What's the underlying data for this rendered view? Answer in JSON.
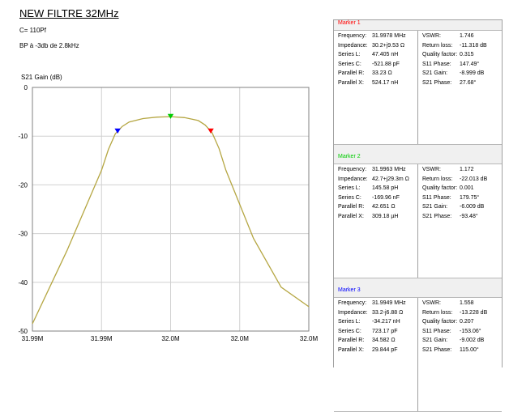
{
  "header": {
    "title": "NEW FILTRE 32MHz",
    "note1": "C= 110Pf",
    "note2": "BP à -3db de 2.8kHz"
  },
  "chart_data": {
    "type": "line",
    "title": "",
    "xlabel": "",
    "ylabel": "S21 Gain (dB)",
    "xlim": [
      31.999,
      32.001
    ],
    "ylim": [
      -50,
      0
    ],
    "x_tick_labels": [
      "31.99M",
      "31.99M",
      "32.0M",
      "32.0M",
      "32.0M"
    ],
    "y_tick_labels": [
      "0",
      "-10",
      "-20",
      "-30",
      "-40",
      "-50"
    ],
    "grid": true,
    "line_color": "#b5a642",
    "series": [
      {
        "x": [
          31.999,
          31.99925,
          31.9995,
          31.99955,
          31.9996,
          31.99965,
          31.9997,
          31.9998,
          31.9999,
          32.0,
          32.0001,
          32.0002,
          32.00025,
          32.0003,
          32.00035,
          32.0004,
          32.0006,
          32.0008,
          32.001
        ],
        "values": [
          -48.5,
          -33.5,
          -17,
          -12.7,
          -9.5,
          -8.0,
          -7.1,
          -6.4,
          -6.1,
          -6.0,
          -6.2,
          -6.8,
          -7.7,
          -9.3,
          -12.5,
          -17,
          -31,
          -41,
          -45
        ]
      }
    ],
    "markers": [
      {
        "label": "1",
        "x": 31.9978,
        "y": -8.999,
        "color": "#ff0000"
      },
      {
        "label": "2",
        "x": 31.9963,
        "y": -6.009,
        "color": "#00cc00"
      },
      {
        "label": "3",
        "x": 31.9949,
        "y": -9.002,
        "color": "#0000ff"
      }
    ]
  },
  "panel": {
    "markers": [
      {
        "title": "Marker 1",
        "color": "#ff0000",
        "left": [
          {
            "k": "Frequency:",
            "v": "31.9978 MHz"
          },
          {
            "k": "Impedance:",
            "v": "30.2+j9.53 Ω"
          },
          {
            "k": "Series L:",
            "v": "47.405 nH"
          },
          {
            "k": "Series C:",
            "v": "-521.88 pF"
          },
          {
            "k": "Parallel R:",
            "v": "33.23 Ω"
          },
          {
            "k": "Parallel X:",
            "v": "524.17 nH"
          }
        ],
        "right": [
          {
            "k": "VSWR:",
            "v": "1.746"
          },
          {
            "k": "Return loss:",
            "v": "-11.318 dB"
          },
          {
            "k": "Quality factor:",
            "v": "0.315"
          },
          {
            "k": "S11 Phase:",
            "v": "147.49°"
          },
          {
            "k": "S21 Gain:",
            "v": "-8.999 dB"
          },
          {
            "k": "S21 Phase:",
            "v": "27.68°"
          }
        ]
      },
      {
        "title": "Marker 2",
        "color": "#00cc00",
        "left": [
          {
            "k": "Frequency:",
            "v": "31.9963 MHz"
          },
          {
            "k": "Impedance:",
            "v": "42.7+j29.3m Ω"
          },
          {
            "k": "Series L:",
            "v": "145.58 pH"
          },
          {
            "k": "Series C:",
            "v": "-169.96 nF"
          },
          {
            "k": "Parallel R:",
            "v": "42.651 Ω"
          },
          {
            "k": "Parallel X:",
            "v": "309.18 µH"
          }
        ],
        "right": [
          {
            "k": "VSWR:",
            "v": "1.172"
          },
          {
            "k": "Return loss:",
            "v": "-22.013 dB"
          },
          {
            "k": "Quality factor:",
            "v": "0.001"
          },
          {
            "k": "S11 Phase:",
            "v": "179.75°"
          },
          {
            "k": "S21 Gain:",
            "v": "-6.009 dB"
          },
          {
            "k": "S21 Phase:",
            "v": "-93.48°"
          }
        ]
      },
      {
        "title": "Marker 3",
        "color": "#0000ff",
        "left": [
          {
            "k": "Frequency:",
            "v": "31.9949 MHz"
          },
          {
            "k": "Impedance:",
            "v": "33.2-j6.88 Ω"
          },
          {
            "k": "Series L:",
            "v": "-34.217 nH"
          },
          {
            "k": "Series C:",
            "v": "723.17 pF"
          },
          {
            "k": "Parallel R:",
            "v": "34.582 Ω"
          },
          {
            "k": "Parallel X:",
            "v": "29.844 pF"
          }
        ],
        "right": [
          {
            "k": "VSWR:",
            "v": "1.558"
          },
          {
            "k": "Return loss:",
            "v": "-13.228 dB"
          },
          {
            "k": "Quality factor:",
            "v": "0.207"
          },
          {
            "k": "S11 Phase:",
            "v": "-153.06°"
          },
          {
            "k": "S21 Gain:",
            "v": "-9.002 dB"
          },
          {
            "k": "S21 Phase:",
            "v": "115.00°"
          }
        ]
      }
    ]
  }
}
